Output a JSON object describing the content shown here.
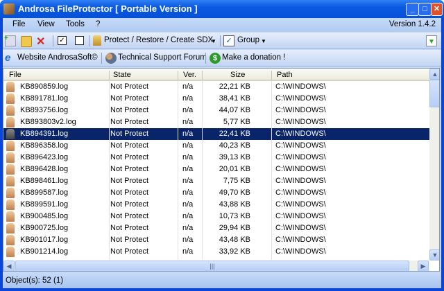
{
  "window": {
    "title": "Androsa FileProtector [ Portable Version ]"
  },
  "menu": {
    "items": [
      "File",
      "View",
      "Tools",
      "?"
    ],
    "version": "Version 1.4.2"
  },
  "toolbar": {
    "protect_label": "Protect / Restore / Create SDX",
    "group_label": "Group"
  },
  "linkbar": {
    "website": "Website AndrosaSoft©",
    "forum": "Technical Support Forum",
    "donate": "Make a donation !"
  },
  "table": {
    "columns": [
      "File",
      "State",
      "Ver.",
      "Size",
      "Path"
    ],
    "selected_index": 4,
    "rows": [
      [
        "KB890859.log",
        "Not Protect",
        "n/a",
        "22,21 KB",
        "C:\\WINDOWS\\"
      ],
      [
        "KB891781.log",
        "Not Protect",
        "n/a",
        "38,41 KB",
        "C:\\WINDOWS\\"
      ],
      [
        "KB893756.log",
        "Not Protect",
        "n/a",
        "44,07 KB",
        "C:\\WINDOWS\\"
      ],
      [
        "KB893803v2.log",
        "Not Protect",
        "n/a",
        "5,77 KB",
        "C:\\WINDOWS\\"
      ],
      [
        "KB894391.log",
        "Not Protect",
        "n/a",
        "22,41 KB",
        "C:\\WINDOWS\\"
      ],
      [
        "KB896358.log",
        "Not Protect",
        "n/a",
        "40,23 KB",
        "C:\\WINDOWS\\"
      ],
      [
        "KB896423.log",
        "Not Protect",
        "n/a",
        "39,13 KB",
        "C:\\WINDOWS\\"
      ],
      [
        "KB896428.log",
        "Not Protect",
        "n/a",
        "20,01 KB",
        "C:\\WINDOWS\\"
      ],
      [
        "KB898461.log",
        "Not Protect",
        "n/a",
        "7,75 KB",
        "C:\\WINDOWS\\"
      ],
      [
        "KB899587.log",
        "Not Protect",
        "n/a",
        "49,70 KB",
        "C:\\WINDOWS\\"
      ],
      [
        "KB899591.log",
        "Not Protect",
        "n/a",
        "43,88 KB",
        "C:\\WINDOWS\\"
      ],
      [
        "KB900485.log",
        "Not Protect",
        "n/a",
        "10,73 KB",
        "C:\\WINDOWS\\"
      ],
      [
        "KB900725.log",
        "Not Protect",
        "n/a",
        "29,94 KB",
        "C:\\WINDOWS\\"
      ],
      [
        "KB901017.log",
        "Not Protect",
        "n/a",
        "43,48 KB",
        "C:\\WINDOWS\\"
      ],
      [
        "KB901214.log",
        "Not Protect",
        "n/a",
        "33,92 KB",
        "C:\\WINDOWS\\"
      ]
    ]
  },
  "status": {
    "text": "Object(s): 52 (1)"
  }
}
